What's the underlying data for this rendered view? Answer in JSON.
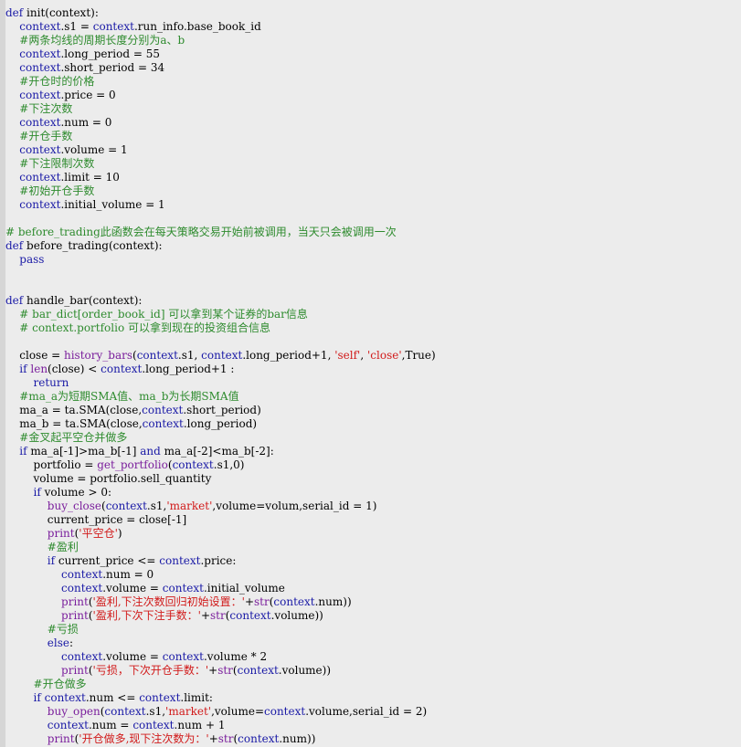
{
  "colors": {
    "background": "#ececec",
    "gutter": "#d6d6d6",
    "keyword": "#1a1aa6",
    "comment": "#2e8b2e",
    "string": "#d11a1a",
    "builtin": "#7a1e9c",
    "text": "#000000"
  },
  "lines": [
    [
      [
        "kw",
        "def"
      ],
      [
        "plain",
        " init(context):"
      ]
    ],
    [
      [
        "plain",
        "    "
      ],
      [
        "ctx",
        "context"
      ],
      [
        "plain",
        ".s1 = "
      ],
      [
        "ctx",
        "context"
      ],
      [
        "plain",
        ".run_info.base_book_id"
      ]
    ],
    [
      [
        "plain",
        "    "
      ],
      [
        "comment",
        "#两条均线的周期长度分别为a、b"
      ]
    ],
    [
      [
        "plain",
        "    "
      ],
      [
        "ctx",
        "context"
      ],
      [
        "plain",
        ".long_period = 55"
      ]
    ],
    [
      [
        "plain",
        "    "
      ],
      [
        "ctx",
        "context"
      ],
      [
        "plain",
        ".short_period = 34"
      ]
    ],
    [
      [
        "plain",
        "    "
      ],
      [
        "comment",
        "#开仓时的价格"
      ]
    ],
    [
      [
        "plain",
        "    "
      ],
      [
        "ctx",
        "context"
      ],
      [
        "plain",
        ".price = 0"
      ]
    ],
    [
      [
        "plain",
        "    "
      ],
      [
        "comment",
        "#下注次数"
      ]
    ],
    [
      [
        "plain",
        "    "
      ],
      [
        "ctx",
        "context"
      ],
      [
        "plain",
        ".num = 0"
      ]
    ],
    [
      [
        "plain",
        "    "
      ],
      [
        "comment",
        "#开仓手数"
      ]
    ],
    [
      [
        "plain",
        "    "
      ],
      [
        "ctx",
        "context"
      ],
      [
        "plain",
        ".volume = 1"
      ]
    ],
    [
      [
        "plain",
        "    "
      ],
      [
        "comment",
        "#下注限制次数"
      ]
    ],
    [
      [
        "plain",
        "    "
      ],
      [
        "ctx",
        "context"
      ],
      [
        "plain",
        ".limit = 10"
      ]
    ],
    [
      [
        "plain",
        "    "
      ],
      [
        "comment",
        "#初始开仓手数"
      ]
    ],
    [
      [
        "plain",
        "    "
      ],
      [
        "ctx",
        "context"
      ],
      [
        "plain",
        ".initial_volume = 1"
      ]
    ],
    [
      [
        "plain",
        ""
      ]
    ],
    [
      [
        "comment",
        "# before_trading此函数会在每天策略交易开始前被调用，当天只会被调用一次"
      ]
    ],
    [
      [
        "kw",
        "def"
      ],
      [
        "plain",
        " before_trading(context):"
      ]
    ],
    [
      [
        "plain",
        "    "
      ],
      [
        "kw",
        "pass"
      ]
    ],
    [
      [
        "plain",
        ""
      ]
    ],
    [
      [
        "plain",
        ""
      ]
    ],
    [
      [
        "kw",
        "def"
      ],
      [
        "plain",
        " handle_bar(context):"
      ]
    ],
    [
      [
        "plain",
        "    "
      ],
      [
        "comment",
        "# bar_dict[order_book_id] 可以拿到某个证券的bar信息"
      ]
    ],
    [
      [
        "plain",
        "    "
      ],
      [
        "comment",
        "# context.portfolio 可以拿到现在的投资组合信息"
      ]
    ],
    [
      [
        "plain",
        ""
      ]
    ],
    [
      [
        "plain",
        "    close = "
      ],
      [
        "builtin",
        "history_bars"
      ],
      [
        "plain",
        "("
      ],
      [
        "ctx",
        "context"
      ],
      [
        "plain",
        ".s1, "
      ],
      [
        "ctx",
        "context"
      ],
      [
        "plain",
        ".long_period+1, "
      ],
      [
        "string",
        "'self'"
      ],
      [
        "plain",
        ", "
      ],
      [
        "string",
        "'close'"
      ],
      [
        "plain",
        ",True)"
      ]
    ],
    [
      [
        "plain",
        "    "
      ],
      [
        "kw",
        "if"
      ],
      [
        "plain",
        " "
      ],
      [
        "builtin",
        "len"
      ],
      [
        "plain",
        "(close) < "
      ],
      [
        "ctx",
        "context"
      ],
      [
        "plain",
        ".long_period+1 :"
      ]
    ],
    [
      [
        "plain",
        "        "
      ],
      [
        "kw",
        "return"
      ]
    ],
    [
      [
        "plain",
        "    "
      ],
      [
        "comment",
        "#ma_a为短期SMA值、ma_b为长期SMA值"
      ]
    ],
    [
      [
        "plain",
        "    ma_a = ta.SMA(close,"
      ],
      [
        "ctx",
        "context"
      ],
      [
        "plain",
        ".short_period)"
      ]
    ],
    [
      [
        "plain",
        "    ma_b = ta.SMA(close,"
      ],
      [
        "ctx",
        "context"
      ],
      [
        "plain",
        ".long_period)"
      ]
    ],
    [
      [
        "plain",
        "    "
      ],
      [
        "comment",
        "#金叉起平空仓并做多"
      ]
    ],
    [
      [
        "plain",
        "    "
      ],
      [
        "kw",
        "if"
      ],
      [
        "plain",
        " ma_a[-1]>ma_b[-1] "
      ],
      [
        "kw",
        "and"
      ],
      [
        "plain",
        " ma_a[-2]<ma_b[-2]:"
      ]
    ],
    [
      [
        "plain",
        "        portfolio = "
      ],
      [
        "builtin",
        "get_portfolio"
      ],
      [
        "plain",
        "("
      ],
      [
        "ctx",
        "context"
      ],
      [
        "plain",
        ".s1,0)"
      ]
    ],
    [
      [
        "plain",
        "        volume = portfolio.sell_quantity"
      ]
    ],
    [
      [
        "plain",
        "        "
      ],
      [
        "kw",
        "if"
      ],
      [
        "plain",
        " volume > 0:"
      ]
    ],
    [
      [
        "plain",
        "            "
      ],
      [
        "builtin",
        "buy_close"
      ],
      [
        "plain",
        "("
      ],
      [
        "ctx",
        "context"
      ],
      [
        "plain",
        ".s1,"
      ],
      [
        "string",
        "'market'"
      ],
      [
        "plain",
        ",volume=volum,serial_id = 1)"
      ]
    ],
    [
      [
        "plain",
        "            current_price = close[-1]"
      ]
    ],
    [
      [
        "plain",
        "            "
      ],
      [
        "builtin",
        "print"
      ],
      [
        "plain",
        "("
      ],
      [
        "string",
        "'平空仓'"
      ],
      [
        "plain",
        ")"
      ]
    ],
    [
      [
        "plain",
        "            "
      ],
      [
        "comment",
        "#盈利"
      ]
    ],
    [
      [
        "plain",
        "            "
      ],
      [
        "kw",
        "if"
      ],
      [
        "plain",
        " current_price <= "
      ],
      [
        "ctx",
        "context"
      ],
      [
        "plain",
        ".price:"
      ]
    ],
    [
      [
        "plain",
        "                "
      ],
      [
        "ctx",
        "context"
      ],
      [
        "plain",
        ".num = 0"
      ]
    ],
    [
      [
        "plain",
        "                "
      ],
      [
        "ctx",
        "context"
      ],
      [
        "plain",
        ".volume = "
      ],
      [
        "ctx",
        "context"
      ],
      [
        "plain",
        ".initial_volume"
      ]
    ],
    [
      [
        "plain",
        "                "
      ],
      [
        "builtin",
        "print"
      ],
      [
        "plain",
        "("
      ],
      [
        "string",
        "'盈利,下注次数回归初始设置：'"
      ],
      [
        "plain",
        "+"
      ],
      [
        "builtin",
        "str"
      ],
      [
        "plain",
        "("
      ],
      [
        "ctx",
        "context"
      ],
      [
        "plain",
        ".num))"
      ]
    ],
    [
      [
        "plain",
        "                "
      ],
      [
        "builtin",
        "print"
      ],
      [
        "plain",
        "("
      ],
      [
        "string",
        "'盈利,下次下注手数：'"
      ],
      [
        "plain",
        "+"
      ],
      [
        "builtin",
        "str"
      ],
      [
        "plain",
        "("
      ],
      [
        "ctx",
        "context"
      ],
      [
        "plain",
        ".volume))"
      ]
    ],
    [
      [
        "plain",
        "            "
      ],
      [
        "comment",
        "#亏损"
      ]
    ],
    [
      [
        "plain",
        "            "
      ],
      [
        "kw",
        "else"
      ],
      [
        "plain",
        ":"
      ]
    ],
    [
      [
        "plain",
        "                "
      ],
      [
        "ctx",
        "context"
      ],
      [
        "plain",
        ".volume = "
      ],
      [
        "ctx",
        "context"
      ],
      [
        "plain",
        ".volume * 2"
      ]
    ],
    [
      [
        "plain",
        "                "
      ],
      [
        "builtin",
        "print"
      ],
      [
        "plain",
        "("
      ],
      [
        "string",
        "'亏损，下次开仓手数：'"
      ],
      [
        "plain",
        "+"
      ],
      [
        "builtin",
        "str"
      ],
      [
        "plain",
        "("
      ],
      [
        "ctx",
        "context"
      ],
      [
        "plain",
        ".volume))"
      ]
    ],
    [
      [
        "plain",
        "        "
      ],
      [
        "comment",
        "#开仓做多"
      ]
    ],
    [
      [
        "plain",
        "        "
      ],
      [
        "kw",
        "if"
      ],
      [
        "plain",
        " "
      ],
      [
        "ctx",
        "context"
      ],
      [
        "plain",
        ".num <= "
      ],
      [
        "ctx",
        "context"
      ],
      [
        "plain",
        ".limit:"
      ]
    ],
    [
      [
        "plain",
        "            "
      ],
      [
        "builtin",
        "buy_open"
      ],
      [
        "plain",
        "("
      ],
      [
        "ctx",
        "context"
      ],
      [
        "plain",
        ".s1,"
      ],
      [
        "string",
        "'market'"
      ],
      [
        "plain",
        ",volume="
      ],
      [
        "ctx",
        "context"
      ],
      [
        "plain",
        ".volume,serial_id = 2)"
      ]
    ],
    [
      [
        "plain",
        "            "
      ],
      [
        "ctx",
        "context"
      ],
      [
        "plain",
        ".num = "
      ],
      [
        "ctx",
        "context"
      ],
      [
        "plain",
        ".num + 1"
      ]
    ],
    [
      [
        "plain",
        "            "
      ],
      [
        "builtin",
        "print"
      ],
      [
        "plain",
        "("
      ],
      [
        "string",
        "'开仓做多,现下注次数为：'"
      ],
      [
        "plain",
        "+"
      ],
      [
        "builtin",
        "str"
      ],
      [
        "plain",
        "("
      ],
      [
        "ctx",
        "context"
      ],
      [
        "plain",
        ".num))"
      ]
    ]
  ]
}
